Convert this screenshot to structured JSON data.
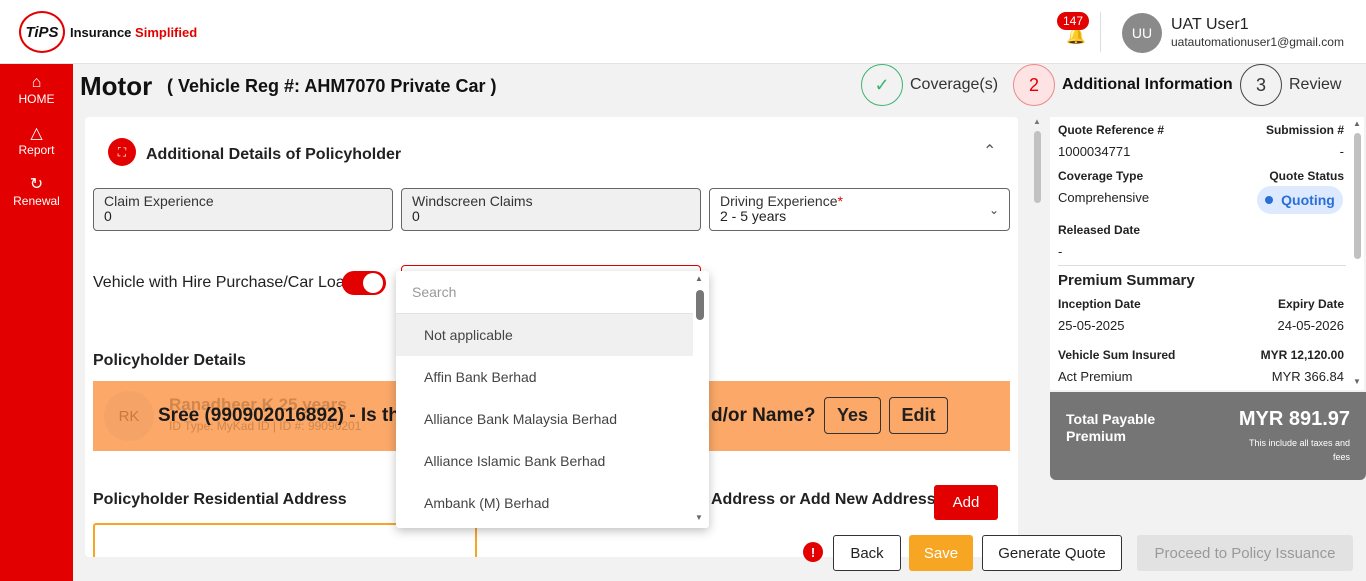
{
  "brand": {
    "logo_text": "TiPS",
    "name_part1": "Insurance",
    "name_part2": "Simplified"
  },
  "header": {
    "notification_count": "147",
    "avatar_initials": "UU",
    "user_name": "UAT User1",
    "user_email": "uatautomationuser1@gmail.com"
  },
  "sidebar": {
    "items": [
      {
        "label": "HOME",
        "icon": "home-icon"
      },
      {
        "label": "Report",
        "icon": "report-icon"
      },
      {
        "label": "Renewal",
        "icon": "renewal-icon"
      }
    ]
  },
  "page": {
    "title": "Motor",
    "subtitle": "( Vehicle Reg #: AHM7070 Private Car )"
  },
  "steps": [
    {
      "number": "",
      "label": "Coverage(s)",
      "state": "done"
    },
    {
      "number": "2",
      "label": "Additional Information",
      "state": "active"
    },
    {
      "number": "3",
      "label": "Review",
      "state": "pending"
    }
  ],
  "section": {
    "title": "Additional Details of Policyholder"
  },
  "fields": {
    "claim_experience": {
      "label": "Claim Experience",
      "value": "0"
    },
    "windscreen_claims": {
      "label": "Windscreen Claims",
      "value": "0"
    },
    "driving_experience": {
      "label": "Driving Experience",
      "required_mark": "*",
      "value": "2 - 5 years"
    }
  },
  "hire_purchase": {
    "label": "Vehicle with Hire Purchase/Car Loan",
    "toggle_on": true
  },
  "dropdown": {
    "search_placeholder": "Search",
    "options": [
      "Not applicable",
      "Affin Bank Berhad",
      "Alliance Bank Malaysia Berhad",
      "Alliance Islamic Bank Berhad",
      "Ambank (M) Berhad"
    ],
    "selected": "Not applicable"
  },
  "policyholder": {
    "title": "Policyholder Details",
    "avatar_initials": "RK",
    "name_line": "Ranadheer K 25 years",
    "id_line": "ID Type: MyKad ID | ID #: 99090201",
    "question_left": "Sree (990902016892) - Is th",
    "question_right": "d/or Name?",
    "yes_label": "Yes",
    "edit_label": "Edit"
  },
  "address": {
    "title": "Policyholder Residential Address",
    "title_right": "Address or Add New Address",
    "add_label": "Add"
  },
  "summary": {
    "quote_ref_label": "Quote Reference #",
    "quote_ref_value": "1000034771",
    "submission_label": "Submission #",
    "submission_value": "-",
    "coverage_type_label": "Coverage Type",
    "coverage_type_value": "Comprehensive",
    "quote_status_label": "Quote Status",
    "quote_status_value": "Quoting",
    "released_label": "Released Date",
    "released_value": "-",
    "premium_title": "Premium Summary",
    "inception_label": "Inception Date",
    "inception_value": "25-05-2025",
    "expiry_label": "Expiry Date",
    "expiry_value": "24-05-2026",
    "sum_insured_label": "Vehicle Sum Insured",
    "sum_insured_value": "MYR 12,120.00",
    "act_premium_label": "Act Premium",
    "act_premium_value": "MYR 366.84"
  },
  "total": {
    "label": "Total Payable Premium",
    "amount": "MYR 891.97",
    "note": "This include all taxes and fees"
  },
  "footer": {
    "back": "Back",
    "save": "Save",
    "generate": "Generate Quote",
    "proceed": "Proceed to Policy Issuance"
  },
  "colors": {
    "brand_red": "#e20000",
    "save_orange": "#f6a623",
    "banner_orange": "#fba868",
    "status_blue": "#2b6fd6"
  }
}
